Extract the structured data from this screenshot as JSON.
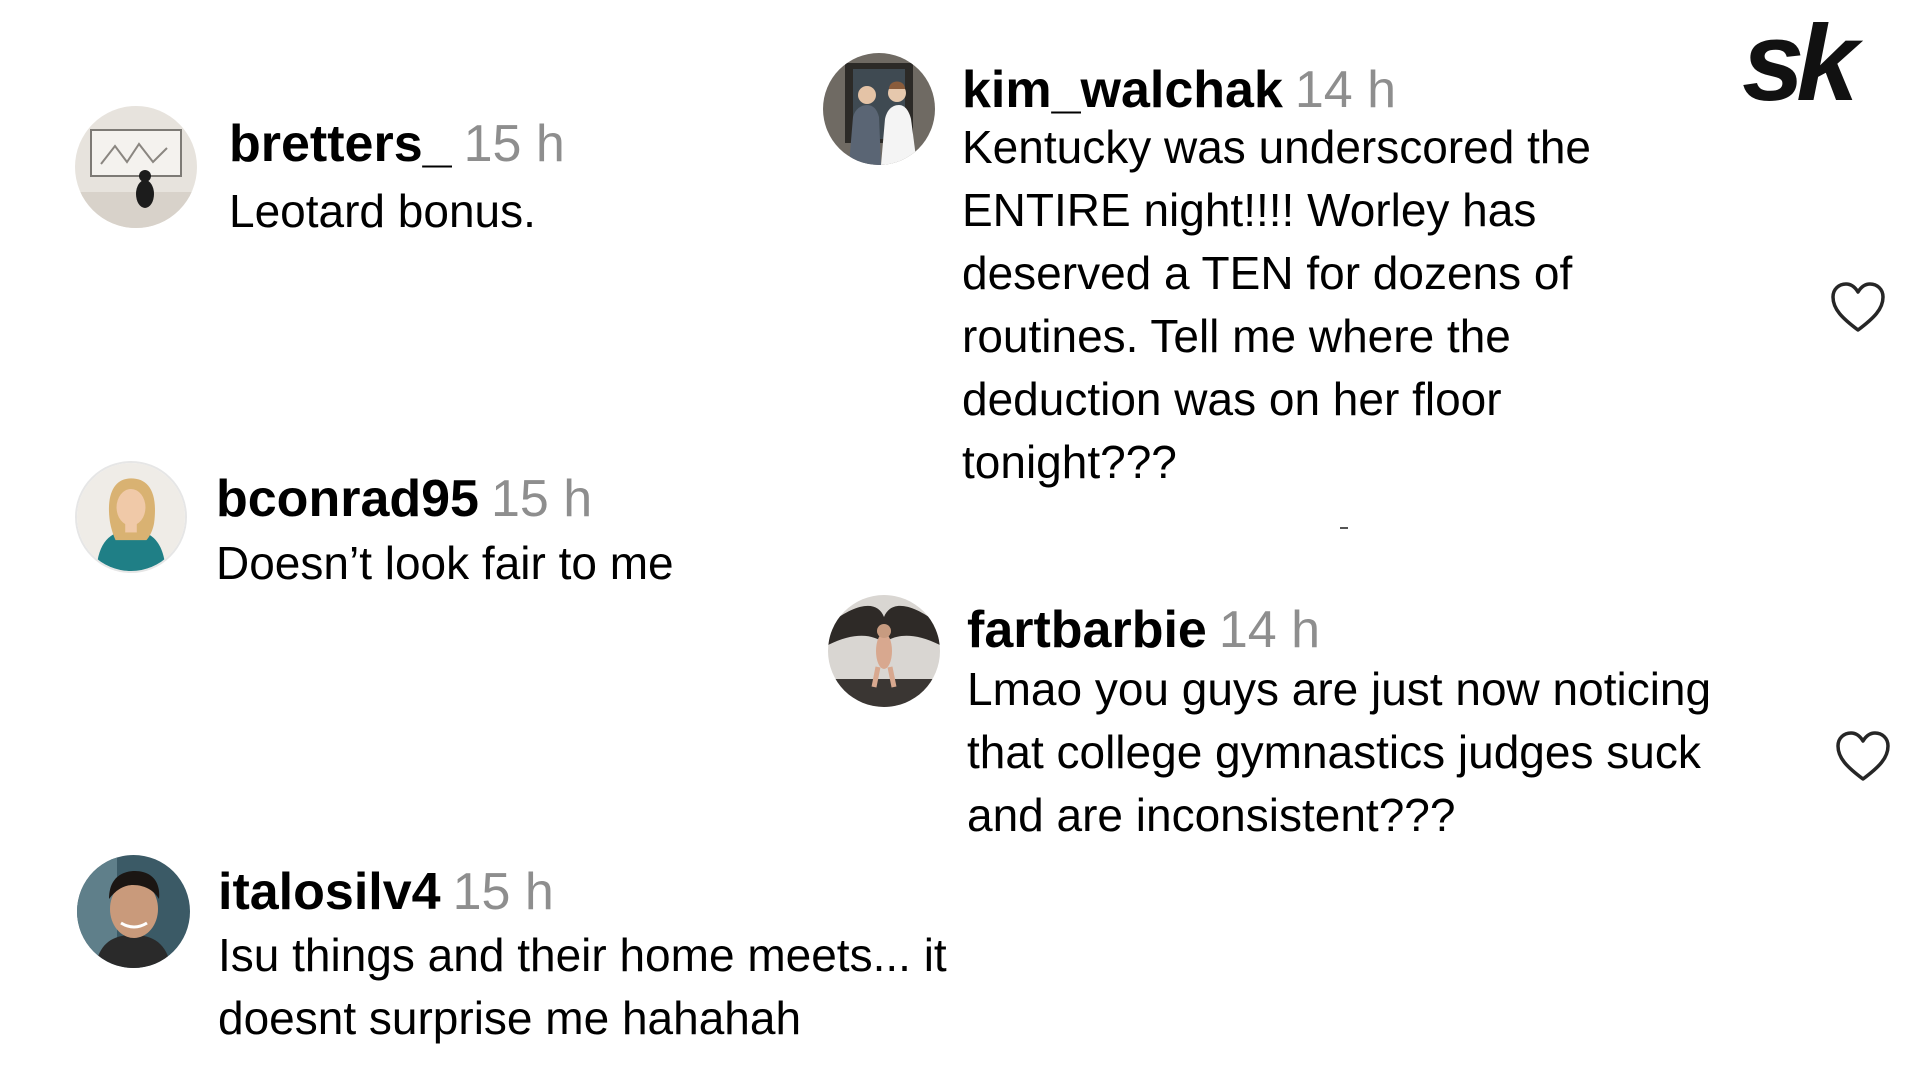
{
  "logo": {
    "text": "sk",
    "color": "#111111"
  },
  "comments": [
    {
      "username": "bretters_",
      "time": "15 h",
      "lines": [
        "Leotard bonus."
      ]
    },
    {
      "username": "bconrad95",
      "time": "15 h",
      "lines": [
        "Doesn’t look fair to me"
      ]
    },
    {
      "username": "italosilv4",
      "time": "15 h",
      "lines": [
        "Isu things and their home meets... it",
        "doesnt surprise me hahahah"
      ]
    },
    {
      "username": "kim_walchak",
      "time": "14 h",
      "lines": [
        "Kentucky was underscored the",
        "ENTIRE night!!!! Worley has",
        "deserved a TEN for dozens of",
        "routines. Tell me where the",
        "deduction was on her floor",
        "tonight???"
      ],
      "heart_icon": "heart-outline-icon"
    },
    {
      "username": "fartbarbie",
      "time": "14 h",
      "lines": [
        "Lmao you guys are just now noticing",
        "that college gymnastics judges suck",
        "and are inconsistent???"
      ],
      "heart_icon": "heart-outline-icon"
    }
  ],
  "colors": {
    "username": "#000000",
    "timestamp": "#8e8e8e",
    "heart_stroke": "#262626"
  }
}
